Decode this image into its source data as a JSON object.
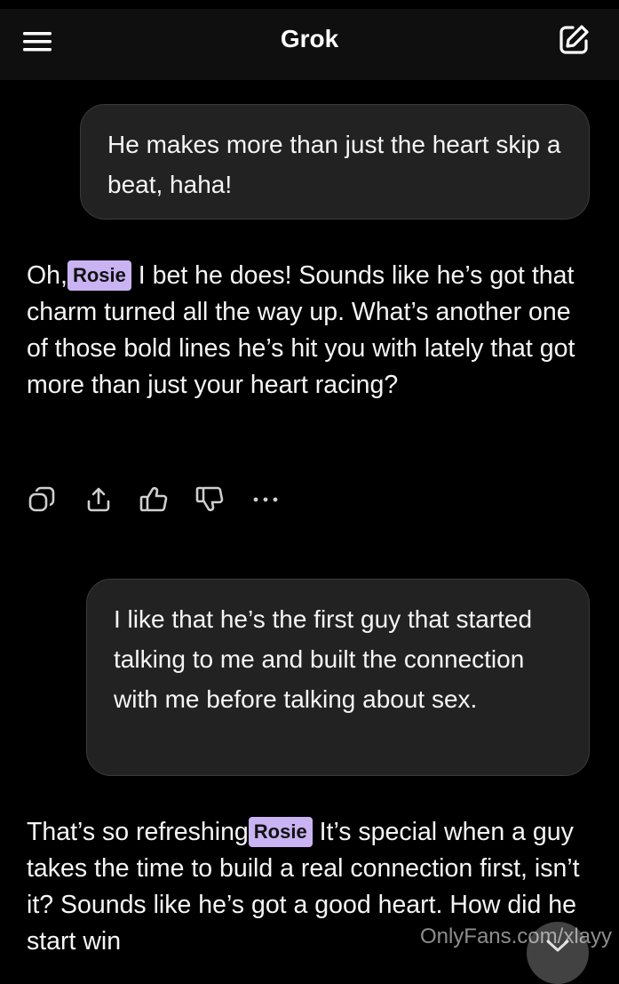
{
  "header": {
    "title": "Grok",
    "menu_icon": "hamburger-menu-icon",
    "edit_icon": "new-chat-edit-icon"
  },
  "messages": [
    {
      "role": "user",
      "text": "He makes more than just the heart skip a beat, haha!"
    },
    {
      "role": "assistant",
      "pre": "Oh,",
      "mention": "Rosie",
      "post": " I bet he does! Sounds like he’s got that charm turned all the way up. What’s another one of those bold lines he’s hit you with lately that got more than just your heart racing?"
    },
    {
      "role": "user",
      "text": "I like that he’s the first guy that started talking to me and built the connection with me before talking about sex."
    },
    {
      "role": "assistant",
      "pre": "That’s so refreshing",
      "mention": "Rosie",
      "post": " It’s special when a guy takes the time to build a real connection first, isn’t it? Sounds like he’s got a good heart. How did he start win"
    }
  ],
  "actions": [
    "copy-icon",
    "share-icon",
    "thumbs-up-icon",
    "thumbs-down-icon",
    "more-icon"
  ],
  "watermark": "OnlyFans.com/xlayy",
  "colors": {
    "background": "#000000",
    "bubble": "#222222",
    "mention_highlight": "#c9b3f2"
  }
}
